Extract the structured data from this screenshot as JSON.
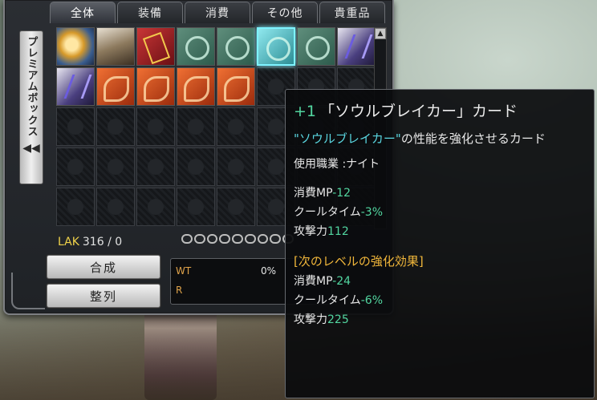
{
  "tabs": [
    {
      "label": "全体",
      "active": true
    },
    {
      "label": "装備",
      "active": false
    },
    {
      "label": "消費",
      "active": false
    },
    {
      "label": "その他",
      "active": false
    },
    {
      "label": "貴重品",
      "active": false
    }
  ],
  "side_panel": {
    "label": "プレミアムボックス",
    "arrow": "◀◀"
  },
  "scroll": {
    "up": "▲"
  },
  "inventory": {
    "row1": [
      "orb",
      "figure-item",
      "card-gold",
      "card-green",
      "card-green",
      "card-cyan",
      "card-green",
      "card-purple"
    ],
    "row2": [
      "card-purple",
      "card-red",
      "card-red",
      "card-red",
      "card-red",
      "empty",
      "empty",
      "empty"
    ],
    "empty_rows": 3,
    "selected_index": 5
  },
  "currency": {
    "label": "LAK",
    "value": "316 / 0"
  },
  "buttons": {
    "combine": "合成",
    "sort": "整列"
  },
  "stats": {
    "wt_label": "WT",
    "wt_value": "0%",
    "r_label": "R"
  },
  "tooltip": {
    "plus": "+1",
    "title": "「ソウルブレイカー」カード",
    "desc_quote": "\"ソウルブレイカー\"",
    "desc_rest": "の性能を強化させるカード",
    "job": "使用職業 :ナイト",
    "current": [
      {
        "label": "消費MP",
        "value": "-12"
      },
      {
        "label": "クールタイム",
        "value": "-3%"
      },
      {
        "label": "攻撃力",
        "value": "112"
      }
    ],
    "next_header": "[次のレベルの強化効果]",
    "next": [
      {
        "label": "消費MP",
        "value": "-24"
      },
      {
        "label": "クールタイム",
        "value": "-6%"
      },
      {
        "label": "攻撃力",
        "value": "225"
      }
    ]
  }
}
